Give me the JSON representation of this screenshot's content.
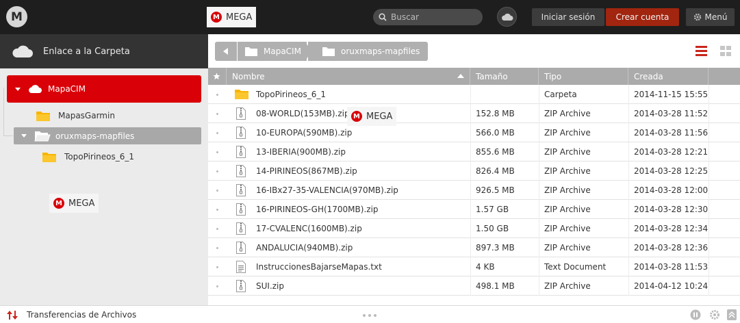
{
  "header": {
    "logo_letter": "M",
    "brand": "MEGA",
    "search_placeholder": "Buscar",
    "login": "Iniciar sesión",
    "create_account": "Crear cuenta",
    "menu": "Menú"
  },
  "watermarks": [
    "MEGA",
    "MEGA"
  ],
  "sidebar": {
    "title": "Enlace a la Carpeta",
    "tree": {
      "root": "MapaCIM",
      "child1": "MapasGarmin",
      "child2": "oruxmaps-mapfiles",
      "grandchild": "TopoPirineos_6_1"
    }
  },
  "breadcrumb": [
    "MapaCIM",
    "oruxmaps-mapfiles"
  ],
  "table": {
    "headers": {
      "name": "Nombre",
      "size": "Tamaño",
      "type": "Tipo",
      "created": "Creada"
    },
    "rows": [
      {
        "icon": "folder-icon",
        "name": "TopoPirineos_6_1",
        "size": "",
        "type": "Carpeta",
        "created": "2014-11-15 15:55"
      },
      {
        "icon": "zip-file-icon",
        "name": "08-WORLD(153MB).zip",
        "size": "152.8 MB",
        "type": "ZIP Archive",
        "created": "2014-03-28 11:52"
      },
      {
        "icon": "zip-file-icon",
        "name": "10-EUROPA(590MB).zip",
        "size": "566.0 MB",
        "type": "ZIP Archive",
        "created": "2014-03-28 11:56"
      },
      {
        "icon": "zip-file-icon",
        "name": "13-IBERIA(900MB).zip",
        "size": "855.6 MB",
        "type": "ZIP Archive",
        "created": "2014-03-28 12:21"
      },
      {
        "icon": "zip-file-icon",
        "name": "14-PIRINEOS(867MB).zip",
        "size": "826.4 MB",
        "type": "ZIP Archive",
        "created": "2014-03-28 12:25"
      },
      {
        "icon": "zip-file-icon",
        "name": "16-IBx27-35-VALENCIA(970MB).zip",
        "size": "926.5 MB",
        "type": "ZIP Archive",
        "created": "2014-03-28 12:00"
      },
      {
        "icon": "zip-file-icon",
        "name": "16-PIRINEOS-GH(1700MB).zip",
        "size": "1.57 GB",
        "type": "ZIP Archive",
        "created": "2014-03-28 12:30"
      },
      {
        "icon": "zip-file-icon",
        "name": "17-CVALENC(1600MB).zip",
        "size": "1.50 GB",
        "type": "ZIP Archive",
        "created": "2014-03-28 12:34"
      },
      {
        "icon": "zip-file-icon",
        "name": "ANDALUCIA(940MB).zip",
        "size": "897.3 MB",
        "type": "ZIP Archive",
        "created": "2014-03-28 12:36"
      },
      {
        "icon": "text-file-icon",
        "name": "InstruccionesBajarseMapas.txt",
        "size": "4 KB",
        "type": "Text Document",
        "created": "2014-03-28 11:53"
      },
      {
        "icon": "zip-file-icon",
        "name": "SUI.zip",
        "size": "498.1 MB",
        "type": "ZIP Archive",
        "created": "2014-04-12 10:24"
      }
    ]
  },
  "footer": {
    "transfers": "Transferencias de Archivos"
  },
  "colors": {
    "accent": "#d90007",
    "create_button": "#a1250f",
    "topbar": "#1e1e1e"
  }
}
